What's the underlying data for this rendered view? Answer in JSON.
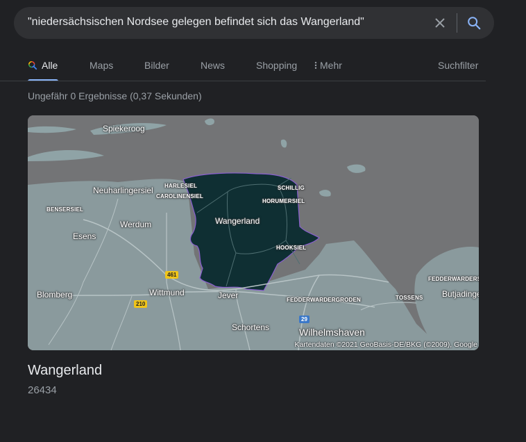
{
  "search": {
    "query": "\"niedersächsischen Nordsee gelegen befindet sich das Wangerland\""
  },
  "tabs": {
    "items": [
      "Alle",
      "Maps",
      "Bilder",
      "News",
      "Shopping",
      "Mehr"
    ],
    "active": "Alle",
    "tools": "Suchfilter"
  },
  "results": {
    "stats": "Ungefähr 0 Ergebnisse (0,37 Sekunden)"
  },
  "map": {
    "labels": {
      "spiekeroog": "Spiekeroog",
      "neuharlingersiel": "Neuharlingersiel",
      "harlesiel": "HARLESIEL",
      "carolinensiel": "CAROLINENSIEL",
      "schillig": "SCHILLIG",
      "horumersiel": "HORUMERSIEL",
      "bensersiel": "BENSERSIEL",
      "werdum": "Werdum",
      "wangerland": "Wangerland",
      "esens": "Esens",
      "hooksiel": "HOOKSIEL",
      "blomberg": "Blomberg",
      "wittmund": "Wittmund",
      "jever": "Jever",
      "fedderwardergroden": "FEDDERWARDERGRODEN",
      "tossens": "TOSSENS",
      "fedderwardersiel": "FEDDERWARDERS",
      "butjadingen": "Butjadinge",
      "schortens": "Schortens",
      "wilhelmshaven": "Wilhelmshaven"
    },
    "roads": {
      "r461": "461",
      "r210": "210",
      "r29": "29"
    },
    "attribution": "Kartendaten ©2021 GeoBasis-DE/BKG (©2009), Google",
    "colors": {
      "water": "#737476",
      "land": "#8a9a9d",
      "region": "#0f2f33",
      "region_border": "#8a5fd0"
    }
  },
  "place": {
    "name": "Wangerland",
    "postal_code": "26434"
  }
}
